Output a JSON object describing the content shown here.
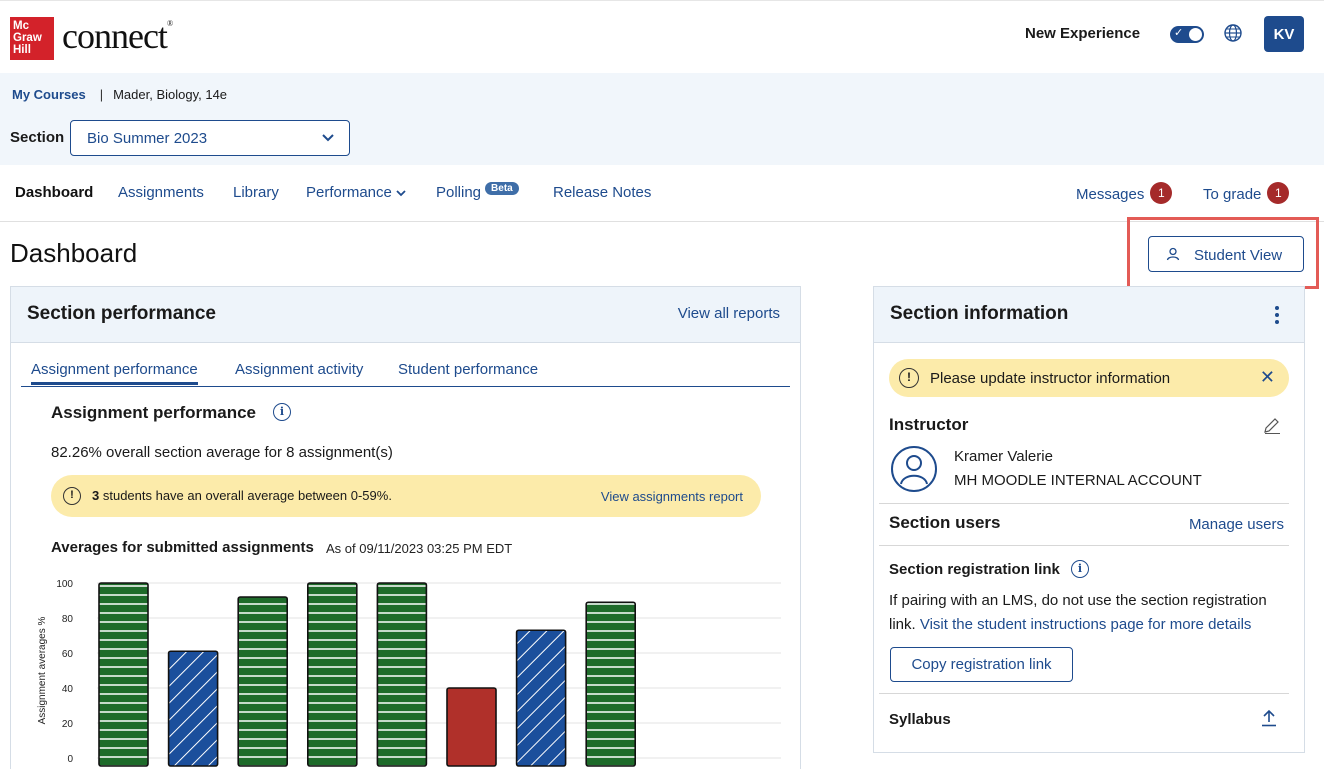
{
  "brand": {
    "logo_lines": [
      "Mc",
      "Graw",
      "Hill"
    ],
    "product": "connect",
    "reg_mark": "®",
    "accent": "#1e4b8d",
    "logo_red": "#d3222a"
  },
  "header": {
    "new_experience_label": "New Experience",
    "toggle_check": "✓",
    "avatar_initials": "KV"
  },
  "breadcrumb": {
    "my_courses": "My Courses",
    "separator": "|",
    "course": "Mader, Biology, 14e"
  },
  "section_select": {
    "label": "Section",
    "value": "Bio Summer 2023"
  },
  "nav": {
    "dashboard": "Dashboard",
    "assignments": "Assignments",
    "library": "Library",
    "performance": "Performance",
    "polling": "Polling",
    "beta": "Beta",
    "release_notes": "Release Notes",
    "messages": "Messages",
    "messages_count": "1",
    "to_grade": "To grade",
    "to_grade_count": "1"
  },
  "page": {
    "title": "Dashboard",
    "student_view": "Student View"
  },
  "performance_card": {
    "title": "Section performance",
    "view_all": "View all reports",
    "tabs": [
      "Assignment performance",
      "Assignment activity",
      "Student performance"
    ],
    "heading": "Assignment performance",
    "info_glyph": "i",
    "average_text": "82.26% overall section average for 8 assignment(s)",
    "warning_glyph": "!",
    "warning_count": "3",
    "warning_text": " students have an overall average between 0-59%.",
    "warning_link": "View assignments report",
    "chart_title": "Averages for submitted assignments",
    "chart_asof": "As of 09/11/2023 03:25 PM EDT"
  },
  "chart_data": {
    "type": "bar",
    "ylabel": "Assignment averages %",
    "ylim": [
      0,
      100
    ],
    "yticks": [
      "0",
      "20",
      "40",
      "60",
      "80",
      "100"
    ],
    "grid": true,
    "values": [
      100,
      61,
      92,
      100,
      100,
      40,
      73,
      89
    ],
    "styles": [
      "green",
      "blue",
      "green",
      "green",
      "green",
      "red",
      "blue",
      "green"
    ],
    "colors": {
      "green": "#1e6b2a",
      "blue": "#1b4f9c",
      "red": "#b0302a"
    }
  },
  "info_card": {
    "title": "Section information",
    "notice_glyph": "!",
    "notice": "Please update instructor information",
    "close_glyph": "✕",
    "instructor_label": "Instructor",
    "instructor_name": "Kramer Valerie",
    "instructor_account": "MH MOODLE INTERNAL ACCOUNT",
    "section_users": "Section users",
    "manage_users": "Manage users",
    "registration_label": "Section registration link",
    "registration_text1": "If pairing with an LMS, do not use the section registration",
    "registration_text2_plain": "link.",
    "registration_text2_link": "Visit the student instructions page for more details",
    "copy_button": "Copy registration link",
    "syllabus": "Syllabus"
  }
}
